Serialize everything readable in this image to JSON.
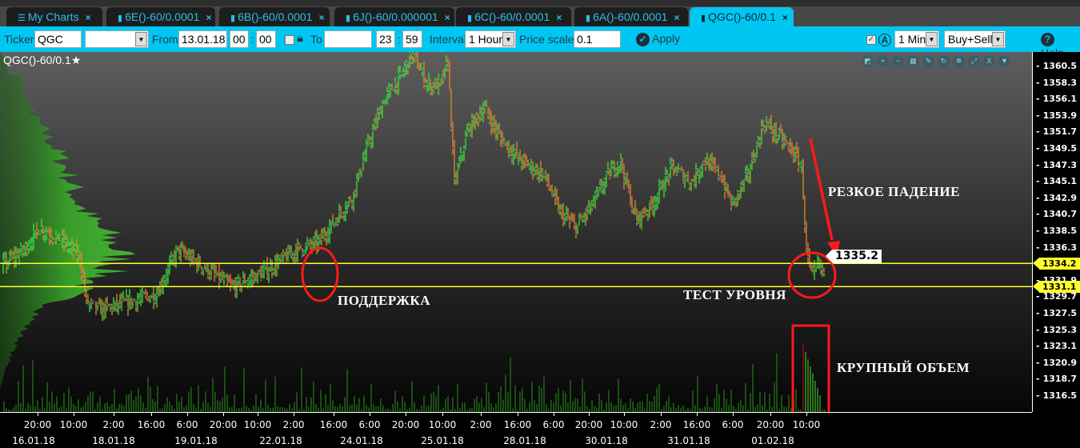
{
  "tabs": [
    {
      "label": "My Charts",
      "icon": "menu-icon",
      "active": false
    },
    {
      "label": "6E()-60/0.0001",
      "icon": "bar-chart-icon",
      "active": false
    },
    {
      "label": "6B()-60/0.0001",
      "icon": "bar-chart-icon",
      "active": false
    },
    {
      "label": "6J()-60/0.000001",
      "icon": "bar-chart-icon",
      "active": false
    },
    {
      "label": "6C()-60/0.0001",
      "icon": "bar-chart-icon",
      "active": false
    },
    {
      "label": "6A()-60/0.0001",
      "icon": "bar-chart-icon",
      "active": false
    },
    {
      "label": "QGC()-60/0.1",
      "icon": "bar-chart-icon",
      "active": true
    }
  ],
  "tab_close": "×",
  "toolbar": {
    "ticker_label": "Ticker",
    "ticker_value": "QGC",
    "ticker_select": "",
    "from_label": "From",
    "from_date": "13.01.18",
    "from_hour": "00",
    "from_min": "00",
    "to_label": "To",
    "to_date": "",
    "to_hour": "23",
    "to_min": "59",
    "colon": ":",
    "interval_label": "Interval",
    "interval_value": "1 Hour",
    "price_scale_label": "Price scale",
    "price_scale_value": "0.1",
    "apply_label": "Apply",
    "checkbox_checked": true,
    "auto_badge": "A",
    "timeframe_value": "1 Min",
    "side_value": "Buy+Sell",
    "help_label": "Help"
  },
  "chart": {
    "title": "QGC()-60/0.1",
    "price_labels": [
      "1360.5",
      "1358.3",
      "1356.1",
      "1353.9",
      "1351.7",
      "1349.5",
      "1347.3",
      "1345.1",
      "1342.9",
      "1340.7",
      "1338.5",
      "1336.3",
      "1331.9",
      "1329.7",
      "1327.5",
      "1325.3",
      "1323.1",
      "1320.9",
      "1318.7",
      "1316.5"
    ],
    "price_range": [
      1316.5,
      1360.5
    ],
    "levels": [
      {
        "price": "1334.2",
        "color": "#ffff2e"
      },
      {
        "price": "1331.1",
        "color": "#ffff2e"
      }
    ],
    "current_price": "1335.2",
    "time_labels": [
      "20:00",
      "10:00",
      "2:00",
      "16:00",
      "6:00",
      "20:00",
      "10:00",
      "2:00",
      "16:00",
      "6:00",
      "20:00",
      "10:00",
      "2:00",
      "16:00",
      "6:00",
      "20:00",
      "10:00",
      "2:00",
      "16:00",
      "6:00",
      "20:00",
      "10:00"
    ],
    "date_labels": [
      "16.01.18",
      "18.01.18",
      "19.01.18",
      "22.01.18",
      "24.01.18",
      "25.01.18",
      "28.01.18",
      "30.01.18",
      "31.01.18",
      "01.02.18"
    ],
    "annotations": {
      "support": "ПОДДЕРЖКА",
      "level_test": "ТЕСТ УРОВНЯ",
      "sharp_drop": "РЕЗКОЕ ПАДЕНИЕ",
      "big_volume": "КРУПНЫЙ ОБЪЕМ"
    },
    "colors": {
      "up": "#3fe03f",
      "down": "#e08a2e",
      "level": "#ffff2e",
      "annotation": "#ff1a1a",
      "profile": "#3aa82a"
    },
    "tool_icons": [
      "zoom-fit-icon",
      "zoom-in-icon",
      "zoom-out-icon",
      "grid-icon",
      "pencil-icon",
      "refresh-icon",
      "settings-icon",
      "expand-icon",
      "close-icon",
      "dropdown-icon"
    ]
  }
}
